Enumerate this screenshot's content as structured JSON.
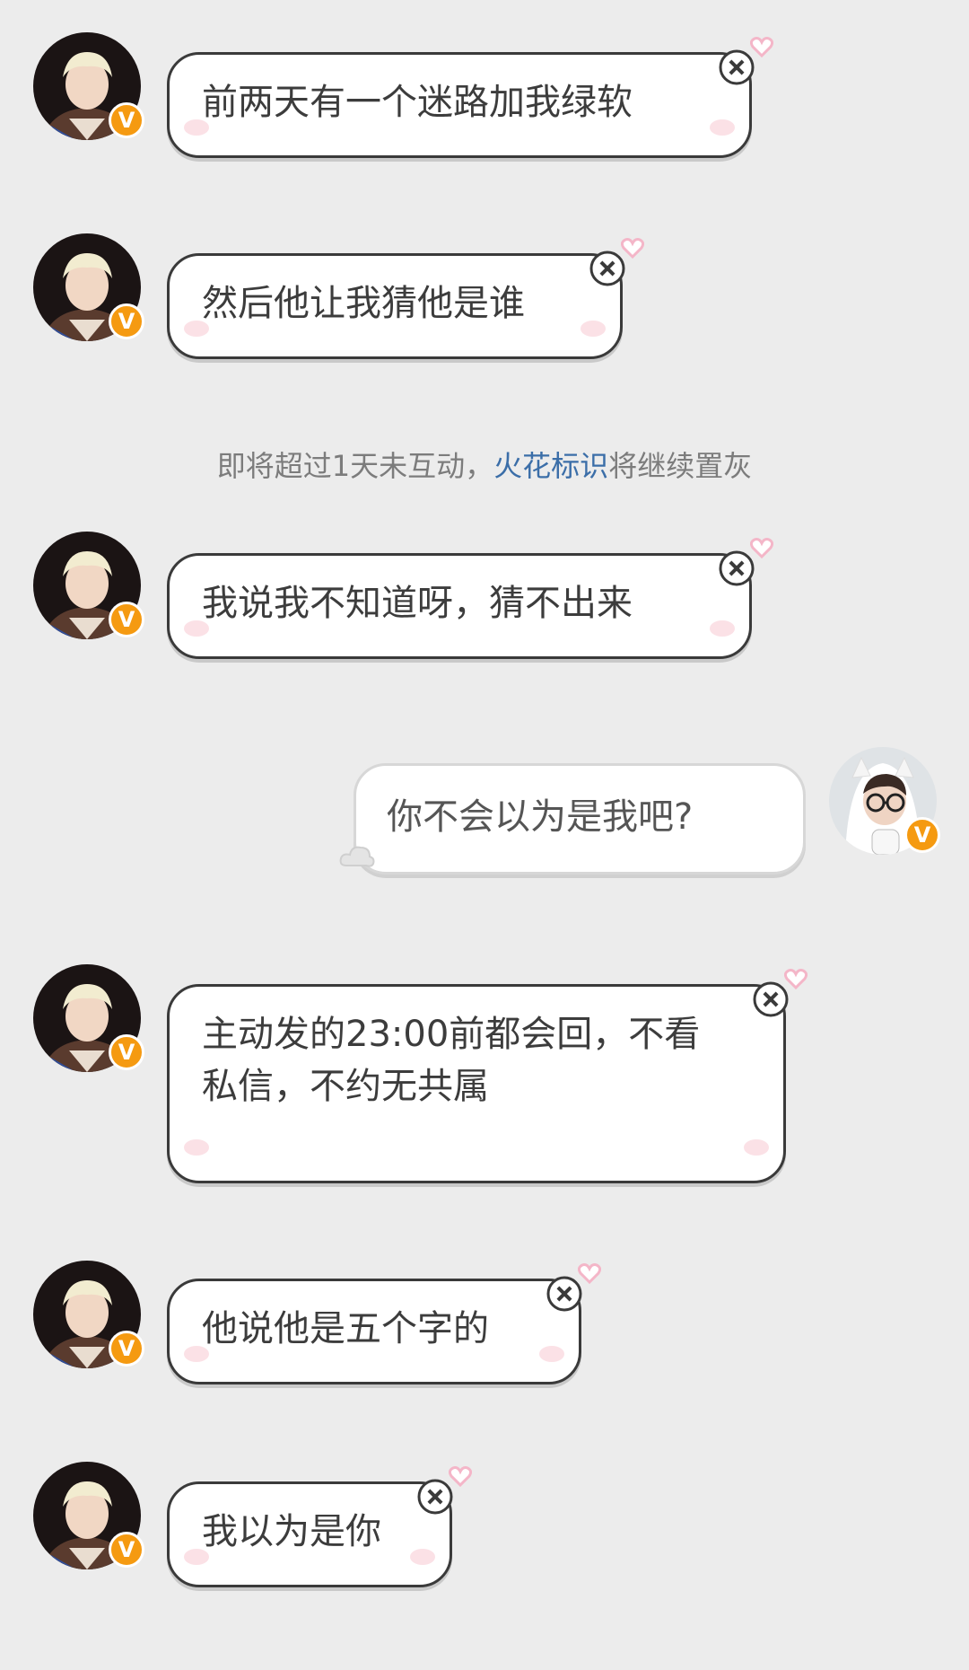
{
  "colors": {
    "background": "#ececec",
    "bubble_border": "#3a3a3a",
    "bubble_text": "#3c3c3c",
    "system_text": "#7c7c7c",
    "link_blue": "#3b6ea8",
    "verified_orange": "#f59a11",
    "heart_pink": "#f4b6c8"
  },
  "messages": [
    {
      "side": "left",
      "text": "前两天有一个迷路加我绿软",
      "avatar_icon": "avatar-blond-boy",
      "badge": "V"
    },
    {
      "side": "left",
      "text": "然后他让我猜他是谁",
      "avatar_icon": "avatar-blond-boy",
      "badge": "V"
    },
    {
      "side": "left",
      "text": "我说我不知道呀，猜不出来",
      "avatar_icon": "avatar-blond-boy",
      "badge": "V"
    },
    {
      "side": "right",
      "text": "你不会以为是我吧?",
      "avatar_icon": "avatar-glasses-white-hood",
      "badge": "V"
    },
    {
      "side": "left",
      "text": "主动发的23:00前都会回，不看私信，不约无共属",
      "avatar_icon": "avatar-blond-boy",
      "badge": "V"
    },
    {
      "side": "left",
      "text": "他说他是五个字的",
      "avatar_icon": "avatar-blond-boy",
      "badge": "V"
    },
    {
      "side": "left",
      "text": "我以为是你",
      "avatar_icon": "avatar-blond-boy",
      "badge": "V"
    }
  ],
  "system_tip": {
    "prefix": "即将超过1天未互动，",
    "link": "火花标识",
    "suffix": "将继续置灰"
  }
}
